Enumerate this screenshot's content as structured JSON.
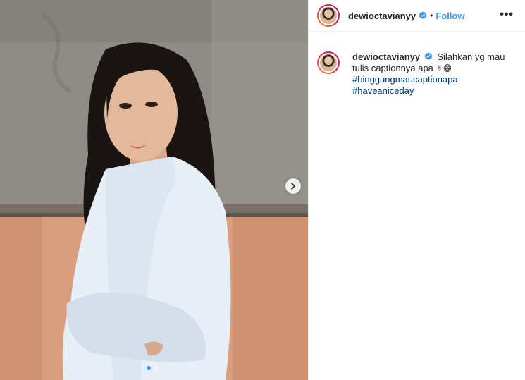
{
  "post": {
    "username": "dewioctavianyy",
    "follow_label": "Follow",
    "separator": "•",
    "more_label": "•••"
  },
  "caption": {
    "username": "dewioctavianyy",
    "text": "Silahkan yg mau tulis captionnya apa",
    "emoji": "✌😁",
    "hashtags": [
      "#binggungmaucaptionapa",
      "#haveaniceday"
    ]
  },
  "carousel": {
    "slide_count": 2,
    "active_slide": 1
  },
  "icons": {
    "verified": "verified-badge-icon",
    "next": "chevron-right-icon",
    "more": "more-options-icon"
  },
  "colors": {
    "link": "#003569",
    "follow": "#3897f0",
    "verified": "#3897f0"
  }
}
